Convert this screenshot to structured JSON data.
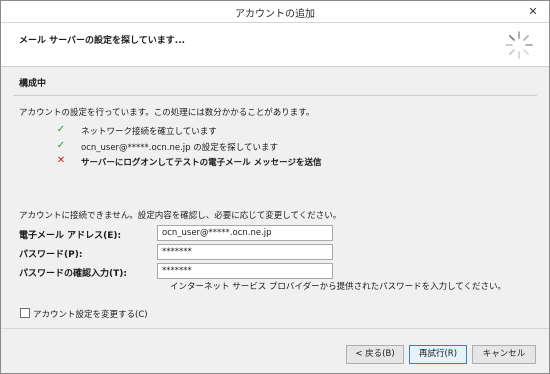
{
  "window": {
    "title": "アカウントの追加",
    "close_glyph": "✕"
  },
  "header": {
    "heading": "メール サーバーの設定を探しています..."
  },
  "section": {
    "title": "構成中"
  },
  "intro": "アカウントの設定を行っています。この処理には数分かかることがあります。",
  "steps": [
    {
      "label": "ネットワーク接続を確立しています",
      "status": "done",
      "icon": "check-icon",
      "glyph": "✓"
    },
    {
      "label": "ocn_user@*****.ocn.ne.jp  の設定を探しています",
      "status": "done",
      "icon": "check-icon",
      "glyph": "✓"
    },
    {
      "label": "サーバーにログオンしてテストの電子メール メッセージを送信",
      "status": "failed",
      "icon": "error-x-icon",
      "glyph": "✕"
    }
  ],
  "error_message": "アカウントに接続できません。設定内容を確認し、必要に応じて変更してください。",
  "form": {
    "email_label": "電子メール アドレス(E):",
    "email_value": "ocn_user@*****.ocn.ne.jp",
    "password_label": "パスワード(P):",
    "password_value": "*******",
    "confirm_label": "パスワードの確認入力(T):",
    "confirm_value": "*******",
    "hint": "インターネット サービス プロバイダーから提供されたパスワードを入力してください。"
  },
  "checkbox": {
    "label": "アカウント設定を変更する(C)",
    "checked": false
  },
  "buttons": {
    "back": "< 戻る(B)",
    "retry": "再試行(R)",
    "cancel": "キャンセル"
  },
  "colors": {
    "success": "#2e9b3a",
    "error": "#d21f1f",
    "primary_button_border": "#3c7fb1"
  }
}
